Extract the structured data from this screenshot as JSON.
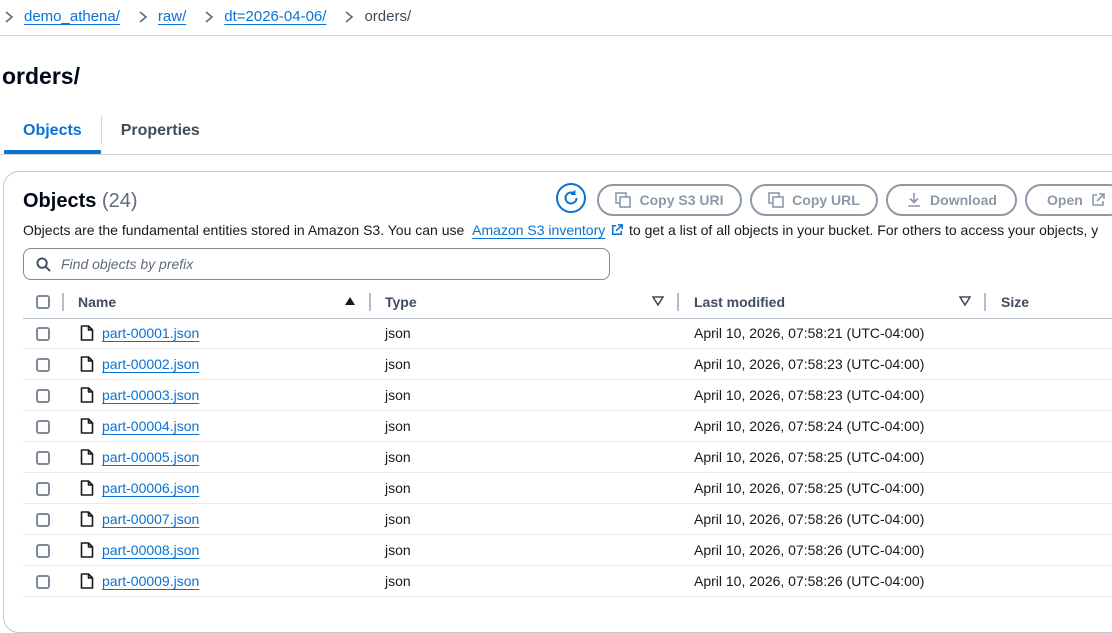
{
  "breadcrumb": [
    {
      "label": "demo_athena/"
    },
    {
      "label": "raw/"
    },
    {
      "label": "dt=2026-04-06/"
    }
  ],
  "breadcrumb_current": "orders/",
  "page_title": "orders/",
  "tabs": [
    {
      "label": "Objects",
      "active": true
    },
    {
      "label": "Properties",
      "active": false
    }
  ],
  "objects_panel": {
    "title": "Objects",
    "count": "(24)",
    "buttons": {
      "copy_uri": "Copy S3 URI",
      "copy_url": "Copy URL",
      "download": "Download",
      "open": "Open"
    },
    "description_before": "Objects are the fundamental entities stored in Amazon S3. You can use",
    "description_link": "Amazon S3 inventory",
    "description_after": "to get a list of all objects in your bucket. For others to access your objects, y",
    "search_placeholder": "Find objects by prefix"
  },
  "table": {
    "columns": {
      "name": "Name",
      "type": "Type",
      "last_modified": "Last modified",
      "size": "Size"
    },
    "rows": [
      {
        "name": "part-00001.json",
        "type": "json",
        "modified": "April 10, 2026, 07:58:21 (UTC-04:00)"
      },
      {
        "name": "part-00002.json",
        "type": "json",
        "modified": "April 10, 2026, 07:58:23 (UTC-04:00)"
      },
      {
        "name": "part-00003.json",
        "type": "json",
        "modified": "April 10, 2026, 07:58:23 (UTC-04:00)"
      },
      {
        "name": "part-00004.json",
        "type": "json",
        "modified": "April 10, 2026, 07:58:24 (UTC-04:00)"
      },
      {
        "name": "part-00005.json",
        "type": "json",
        "modified": "April 10, 2026, 07:58:25 (UTC-04:00)"
      },
      {
        "name": "part-00006.json",
        "type": "json",
        "modified": "April 10, 2026, 07:58:25 (UTC-04:00)"
      },
      {
        "name": "part-00007.json",
        "type": "json",
        "modified": "April 10, 2026, 07:58:26 (UTC-04:00)"
      },
      {
        "name": "part-00008.json",
        "type": "json",
        "modified": "April 10, 2026, 07:58:26 (UTC-04:00)"
      },
      {
        "name": "part-00009.json",
        "type": "json",
        "modified": "April 10, 2026, 07:58:26 (UTC-04:00)"
      }
    ]
  },
  "colors": {
    "link": "#0972d3",
    "disabled_button": "#8d99a8",
    "border": "#d1d5db"
  }
}
